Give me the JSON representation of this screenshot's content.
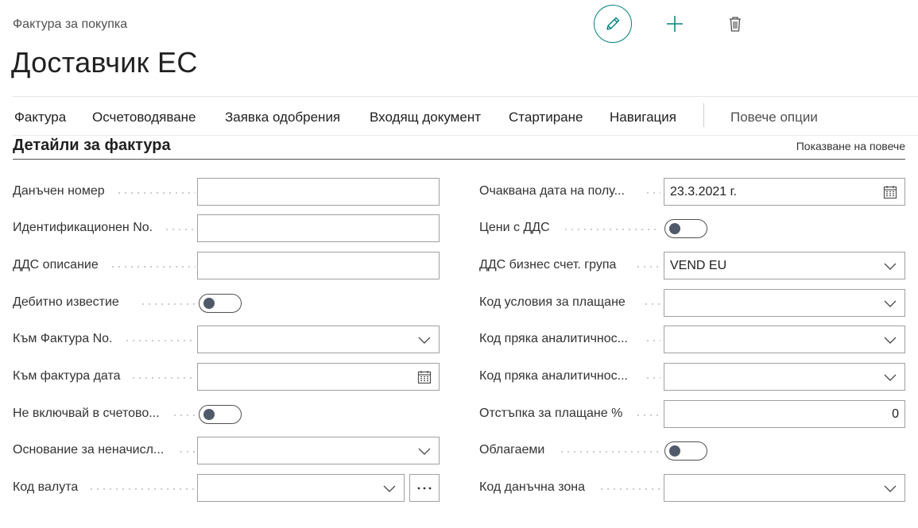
{
  "header": {
    "caption": "Фактура за покупка",
    "title": "Доставчик ЕС"
  },
  "actions": {
    "edit_icon": "pencil-icon",
    "add_icon": "plus-icon",
    "delete_icon": "trash-icon"
  },
  "action_bar": {
    "tabs": [
      "Фактура",
      "Осчетоводяване",
      "Заявка одобрения",
      "Входящ документ",
      "Стартиране",
      "Навигация"
    ],
    "more": "Повече опции"
  },
  "section": {
    "title": "Детайли за фактура",
    "show_more": "Показване на повече"
  },
  "left_fields": [
    {
      "label": "Данъчен номер",
      "type": "text",
      "value": ""
    },
    {
      "label": "Идентификационен No.",
      "type": "text",
      "value": ""
    },
    {
      "label": "ДДС описание",
      "type": "text",
      "value": ""
    },
    {
      "label": "Дебитно известие",
      "type": "toggle",
      "value": "off"
    },
    {
      "label": "Към Фактура No.",
      "type": "dropdown",
      "value": ""
    },
    {
      "label": "Към фактура дата",
      "type": "date",
      "value": ""
    },
    {
      "label": "Не включвай в счетово...",
      "type": "toggle",
      "value": "off"
    },
    {
      "label": "Основание за неначисл...",
      "type": "dropdown",
      "value": ""
    },
    {
      "label": "Код валута",
      "type": "dropdown-ellipsis",
      "value": ""
    }
  ],
  "right_fields": [
    {
      "label": "Очаквана дата на полу...",
      "type": "date",
      "value": "23.3.2021 г."
    },
    {
      "label": "Цени с ДДС",
      "type": "toggle",
      "value": "off"
    },
    {
      "label": "ДДС бизнес счет. група",
      "type": "dropdown",
      "value": "VEND EU"
    },
    {
      "label": "Код условия за плащане",
      "type": "dropdown",
      "value": ""
    },
    {
      "label": "Код пряка аналитичнос...",
      "type": "dropdown",
      "value": ""
    },
    {
      "label": "Код пряка аналитичнос...",
      "type": "dropdown",
      "value": ""
    },
    {
      "label": "Отстъпка за плащане %",
      "type": "number",
      "value": "0"
    },
    {
      "label": "Облагаеми",
      "type": "toggle",
      "value": "off"
    },
    {
      "label": "Код данъчна зона",
      "type": "dropdown",
      "value": ""
    }
  ],
  "colors": {
    "accent": "#00827f",
    "border": "#a0a0a0",
    "text": "#212121"
  }
}
